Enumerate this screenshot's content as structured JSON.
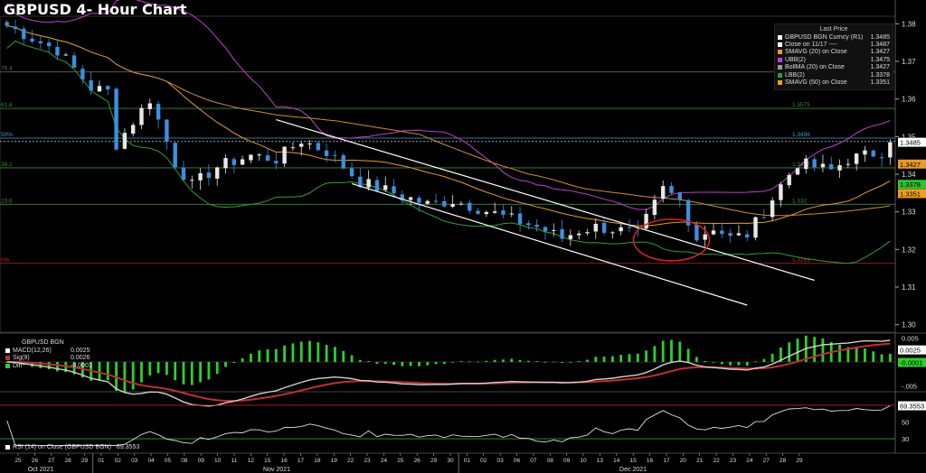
{
  "title": "GBPUSD 4- Hour Chart",
  "colors": {
    "background": "#000000",
    "up": "#e8e8e8",
    "down": "#3d8fe0",
    "smavg20": "#e69a2e",
    "smavg50": "#f0a020",
    "ubb": "#c040d0",
    "lbb": "#30a030",
    "fib": "#3a8a3a",
    "fib0": "#c82020",
    "channel": "#ffffff",
    "circle": "#e02020",
    "macd": "#d0d0d0",
    "sig": "#c03030",
    "diff": "#2cd02c",
    "rsi": "#e0e0e0",
    "lastprice": "#ffffff"
  },
  "legend": {
    "header": "Last Price",
    "items": [
      {
        "name": "GBPUSD BGN Curncy  (R1)",
        "value": "1.3485",
        "color": "#ffffff"
      },
      {
        "name": "Close on 11/17 ----",
        "value": "1.3487",
        "color": "#ffffff"
      },
      {
        "name": "SMAVG (20)  on Close",
        "value": "1.3427",
        "color": "#e69a2e"
      },
      {
        "name": "UBB(2)",
        "value": "1.3475",
        "color": "#c040d0"
      },
      {
        "name": "BollMA (20)  on Close",
        "value": "1.3427",
        "color": "#9a9a9a"
      },
      {
        "name": "LBB(2)",
        "value": "1.3378",
        "color": "#30a030"
      },
      {
        "name": "SMAVG (50)  on Close",
        "value": "1.3351",
        "color": "#f0a020"
      }
    ]
  },
  "fib_labels": [
    {
      "left": "76.4",
      "right": "",
      "value": 1.3672
    },
    {
      "left": "61.8",
      "right": "1.3575",
      "value": 1.3575
    },
    {
      "left": "50%",
      "right": "1.3496",
      "value": 1.3496
    },
    {
      "left": "38.2",
      "right": "1.3417",
      "value": 1.3417
    },
    {
      "left": "23.6",
      "right": "1.332",
      "value": 1.332
    },
    {
      "left": "0%",
      "right": "1.3163",
      "value": 1.3163
    }
  ],
  "price_badges": [
    {
      "text": "1.3485",
      "value": 1.3485,
      "bg": "#ffffff",
      "fg": "#000000"
    },
    {
      "text": "1.3427",
      "value": 1.3427,
      "bg": "#e69a2e",
      "fg": "#000000"
    },
    {
      "text": "1.3378",
      "value": 1.3378,
      "bg": "#30c030",
      "fg": "#000000"
    },
    {
      "text": "1.3351",
      "value": 1.3351,
      "bg": "#f0a020",
      "fg": "#000000"
    }
  ],
  "macd_legend": {
    "title": "GBPUSD BGN",
    "items": [
      {
        "name": "MACD(12,26)",
        "value": "0.0025",
        "color": "#ffffff"
      },
      {
        "name": "Sig(9)",
        "value": "0.0026",
        "color": "#c03030"
      },
      {
        "name": "Diff",
        "value": "-0.0001",
        "color": "#2cd02c"
      }
    ]
  },
  "macd_badges": [
    {
      "text": "0.0025",
      "value": 0.0025,
      "bg": "#ffffff",
      "fg": "#000"
    },
    {
      "text": "-0.0001",
      "value": -0.0001,
      "bg": "#2cd02c",
      "fg": "#000"
    }
  ],
  "rsi_legend": {
    "name": "RSI (14)  on Close (GBPUSD BGN)",
    "value": "69.3553",
    "color": "#ffffff"
  },
  "rsi_badges": [
    {
      "text": "69.3553",
      "value": 69.3553,
      "bg": "#ffffff",
      "fg": "#000"
    }
  ],
  "months": [
    "Oct 2021",
    "Nov 2021",
    "Dec 2021"
  ],
  "chart_data": {
    "type": "candlestick",
    "title": "GBPUSD 4- Hour Chart",
    "x_ticks": [
      "25",
      "26",
      "27",
      "28",
      "29",
      "01",
      "02",
      "03",
      "04",
      "05",
      "08",
      "09",
      "10",
      "11",
      "12",
      "15",
      "16",
      "17",
      "18",
      "19",
      "22",
      "23",
      "24",
      "25",
      "26",
      "29",
      "30",
      "01",
      "02",
      "03",
      "06",
      "07",
      "08",
      "09",
      "10",
      "13",
      "14",
      "15",
      "16",
      "17",
      "20",
      "21",
      "22",
      "23",
      "24",
      "27",
      "28",
      "29"
    ],
    "price_axis": {
      "ylim": [
        1.298,
        1.382
      ],
      "ticks": [
        1.3,
        1.31,
        1.32,
        1.33,
        1.34,
        1.35,
        1.36,
        1.37,
        1.38
      ]
    },
    "close_anchors": [
      [
        0,
        1.3795
      ],
      [
        4,
        1.375
      ],
      [
        6,
        1.373
      ],
      [
        10,
        1.363
      ],
      [
        12,
        1.362
      ],
      [
        13,
        1.348
      ],
      [
        16,
        1.357
      ],
      [
        17,
        1.36
      ],
      [
        20,
        1.343
      ],
      [
        22,
        1.337
      ],
      [
        25,
        1.342
      ],
      [
        29,
        1.345
      ],
      [
        32,
        1.344
      ],
      [
        35,
        1.349
      ],
      [
        38,
        1.346
      ],
      [
        42,
        1.338
      ],
      [
        46,
        1.335
      ],
      [
        50,
        1.332
      ],
      [
        53,
        1.333
      ],
      [
        56,
        1.331
      ],
      [
        60,
        1.328
      ],
      [
        63,
        1.326
      ],
      [
        66,
        1.323
      ],
      [
        68,
        1.325
      ],
      [
        70,
        1.326
      ],
      [
        73,
        1.325
      ],
      [
        75,
        1.324
      ],
      [
        78,
        1.336
      ],
      [
        80,
        1.333
      ],
      [
        82,
        1.323
      ],
      [
        84,
        1.326
      ],
      [
        86,
        1.323
      ],
      [
        88,
        1.324
      ],
      [
        90,
        1.33
      ],
      [
        92,
        1.337
      ],
      [
        94,
        1.343
      ],
      [
        96,
        1.342
      ],
      [
        98,
        1.341
      ],
      [
        100,
        1.344
      ],
      [
        102,
        1.345
      ],
      [
        104,
        1.346
      ],
      [
        105,
        1.3485
      ]
    ],
    "indicators": {
      "smavg20": "SMAVG (20)  on Close",
      "smavg50": "SMAVG (50)  on Close",
      "bollinger": [
        "UBB(2)",
        "BollMA (20)  on Close",
        "LBB(2)"
      ]
    },
    "channel_lines": [
      {
        "from": [
          32,
          1.3545
        ],
        "to": [
          96,
          1.3118
        ]
      },
      {
        "from": [
          41,
          1.3375
        ],
        "to": [
          88,
          1.3052
        ]
      }
    ],
    "macd_axis": {
      "ylim": [
        -0.0058,
        0.0058
      ],
      "ticks": [
        0.005,
        0.0,
        -0.005
      ],
      "tick_labels": [
        "0.005",
        ".000",
        "-.005"
      ]
    },
    "rsi_axis": {
      "ylim": [
        15,
        85
      ],
      "ticks": [
        70,
        50,
        30
      ],
      "tick_labels": [
        "70",
        "50",
        "30"
      ],
      "bands": [
        70,
        30
      ]
    }
  }
}
